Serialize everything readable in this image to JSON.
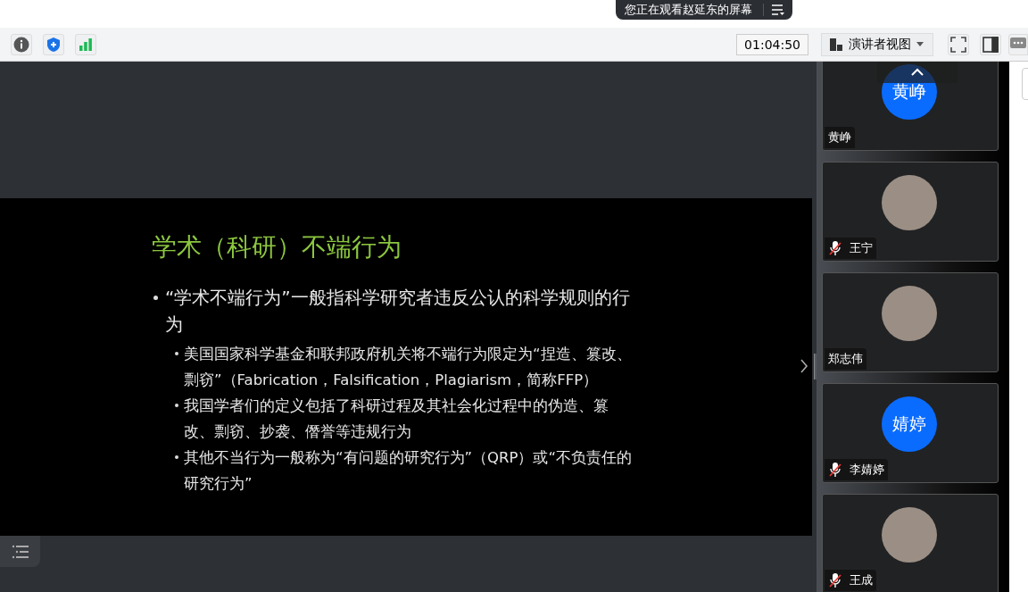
{
  "banner": {
    "text": "您正在观看赵延东的屏幕"
  },
  "toolbar": {
    "timer": "01:04:50",
    "view_menu": "演讲者视图"
  },
  "slide": {
    "title": "学术（科研）不端行为",
    "bullets": [
      {
        "text": "“学术不端行为”一般指科学研究者违反公认的科学规则的行为",
        "children": [
          {
            "text": "美国国家科学基金和联邦政府机关将不端行为限定为“捏造、篡改、剽窃”（Fabrication，Falsification，Plagiarism，简称FFP）"
          },
          {
            "text": "我国学者们的定义包括了科研过程及其社会化过程中的伪造、篡改、剽窃、抄袭、僭誉等违规行为"
          },
          {
            "text": "其他不当行为一般称为“有问题的研究行为”（QRP）或“不负责任的研究行为”"
          }
        ]
      }
    ]
  },
  "participants": [
    {
      "name": "黄峥",
      "muted": false,
      "avatar": {
        "kind": "initials",
        "text": "黄峥"
      }
    },
    {
      "name": "王宁",
      "muted": true,
      "avatar": {
        "kind": "photo"
      }
    },
    {
      "name": "郑志伟",
      "muted": false,
      "avatar": {
        "kind": "photo"
      }
    },
    {
      "name": "李婧婷",
      "muted": true,
      "avatar": {
        "kind": "initials",
        "text": "婧婷"
      }
    },
    {
      "name": "王成",
      "muted": true,
      "avatar": {
        "kind": "photo"
      }
    }
  ]
}
